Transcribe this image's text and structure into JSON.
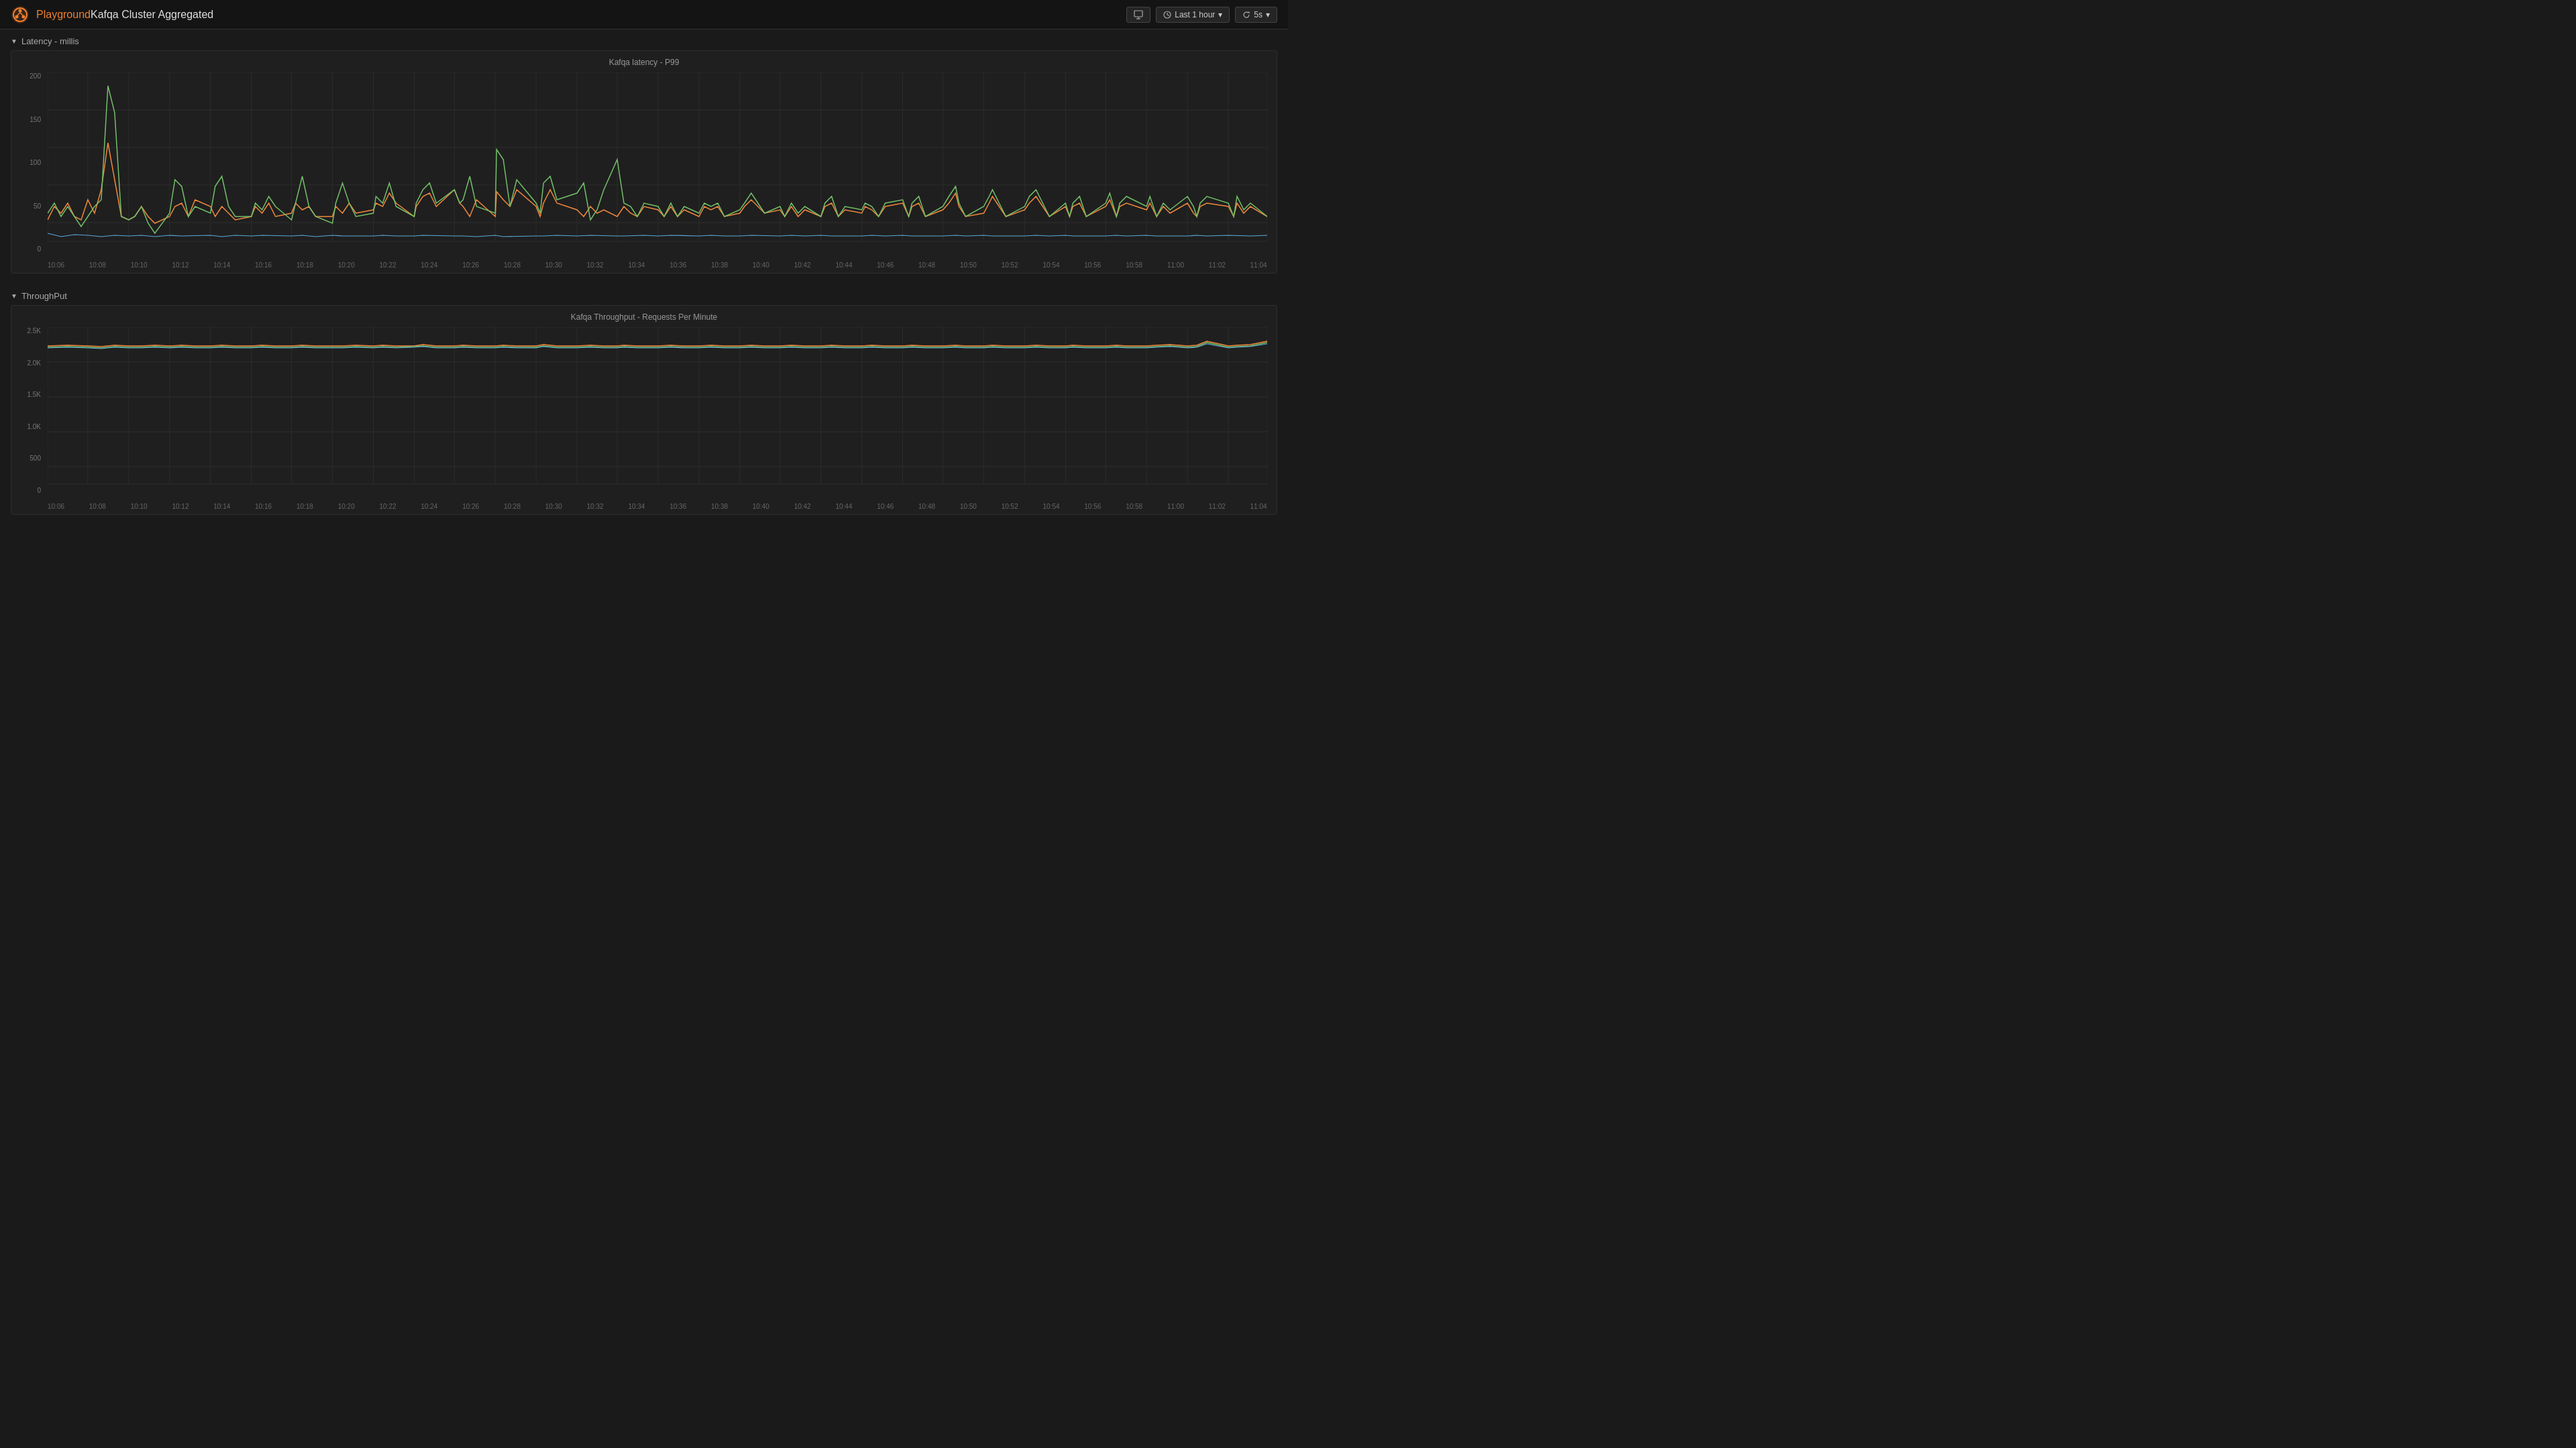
{
  "header": {
    "title_prefix": "Playground",
    "title_main": "Kafqa Cluster Aggregated",
    "time_range_label": "Last 1 hour",
    "refresh_label": "5s"
  },
  "latency_section": {
    "title": "Latency - millis",
    "chart_title": "Kafqa latency - P99",
    "y_labels": [
      "200",
      "150",
      "100",
      "50",
      "0"
    ],
    "x_labels": [
      "10:06",
      "10:08",
      "10:10",
      "10:12",
      "10:14",
      "10:16",
      "10:18",
      "10:20",
      "10:22",
      "10:24",
      "10:26",
      "10:28",
      "10:30",
      "10:32",
      "10:34",
      "10:36",
      "10:38",
      "10:40",
      "10:42",
      "10:44",
      "10:46",
      "10:48",
      "10:50",
      "10:52",
      "10:54",
      "10:56",
      "10:58",
      "11:00",
      "11:02",
      "11:04"
    ]
  },
  "throughput_section": {
    "title": "ThroughPut",
    "chart_title": "Kafqa Throughput - Requests Per Minute",
    "y_labels": [
      "2.5K",
      "2.0K",
      "1.5K",
      "1.0K",
      "500",
      "0"
    ],
    "x_labels": [
      "10:06",
      "10:08",
      "10:10",
      "10:12",
      "10:14",
      "10:16",
      "10:18",
      "10:20",
      "10:22",
      "10:24",
      "10:26",
      "10:28",
      "10:30",
      "10:32",
      "10:34",
      "10:36",
      "10:38",
      "10:40",
      "10:42",
      "10:44",
      "10:46",
      "10:48",
      "10:50",
      "10:52",
      "10:54",
      "10:56",
      "10:58",
      "11:00",
      "11:02",
      "11:04"
    ]
  },
  "colors": {
    "orange": "#f0883e",
    "green": "#73bf69",
    "blue": "#5aa9d8",
    "background": "#1a1a1a",
    "header_bg": "#141414",
    "chart_bg": "#1f1f1f"
  }
}
